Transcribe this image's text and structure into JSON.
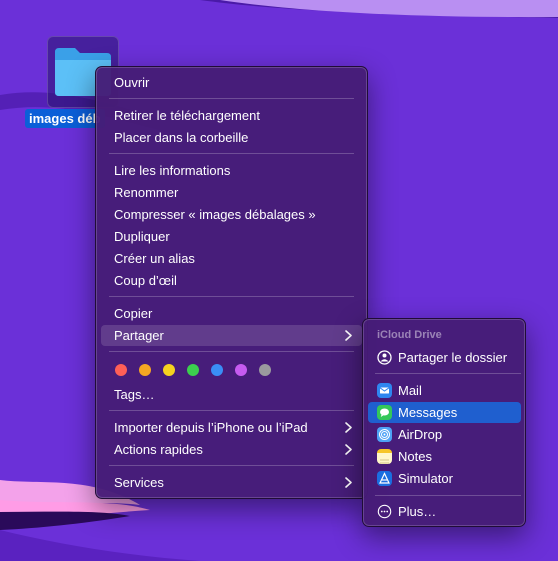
{
  "desktop": {
    "folder": {
      "name": "images déb",
      "icon": "folder-icon"
    }
  },
  "context_menu": {
    "open": "Ouvrir",
    "remove_download": "Retirer le téléchargement",
    "move_to_trash": "Placer dans la corbeille",
    "get_info": "Lire les informations",
    "rename": "Renommer",
    "compress": "Compresser « images débalages »",
    "duplicate": "Dupliquer",
    "make_alias": "Créer un alias",
    "quick_look": "Coup d’œil",
    "copy": "Copier",
    "share": "Partager",
    "tags_colors": [
      "#ff5f57",
      "#f5a623",
      "#f6d21f",
      "#3ccf4e",
      "#3a8ef6",
      "#c65bf0",
      "#9a9a9e"
    ],
    "tags": "Tags…",
    "import_from_iphone": "Importer depuis l’iPhone ou l’iPad",
    "quick_actions": "Actions rapides",
    "services": "Services"
  },
  "share_submenu": {
    "header": "iCloud Drive",
    "share_folder": "Partager le dossier",
    "items": [
      {
        "label": "Mail",
        "icon": "mail-icon"
      },
      {
        "label": "Messages",
        "icon": "messages-icon"
      },
      {
        "label": "AirDrop",
        "icon": "airdrop-icon"
      },
      {
        "label": "Notes",
        "icon": "notes-icon"
      },
      {
        "label": "Simulator",
        "icon": "simulator-icon"
      }
    ],
    "more": "Plus…"
  },
  "colors": {
    "highlight_blue": "#1f5fcf",
    "menu_bg": "#461c76",
    "desktop": "#6a2fd6"
  }
}
